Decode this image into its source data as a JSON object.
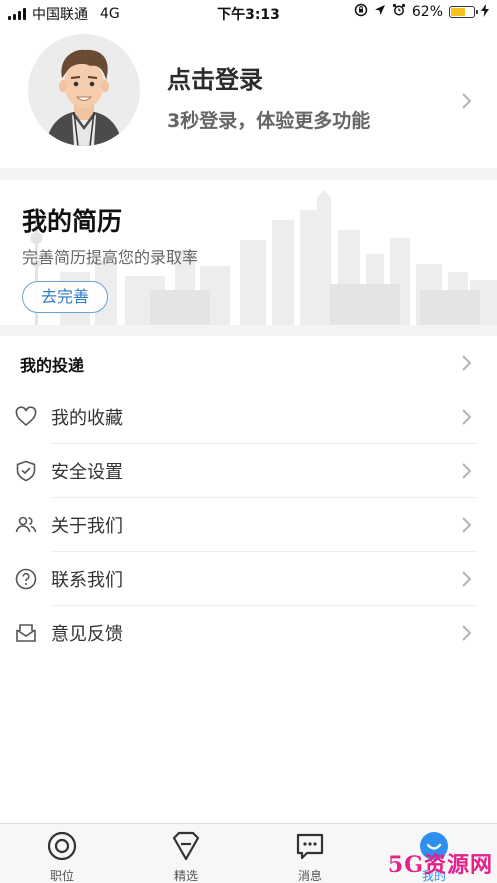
{
  "status_bar": {
    "carrier": "中国联通",
    "network": "4G",
    "time": "下午3:13",
    "battery_percent": "62%",
    "battery_level": 0.62,
    "battery_color": "#f5c11f"
  },
  "profile": {
    "avatar_icon": "user-avatar",
    "title": "点击登录",
    "subtitle": "3秒登录，体验更多功能"
  },
  "resume": {
    "title": "我的简历",
    "subtitle": "完善简历提高您的录取率",
    "button_label": "去完善",
    "accent": "#2f7bc4"
  },
  "menu": {
    "items": [
      {
        "label": "我的投递",
        "icon": "none"
      },
      {
        "label": "我的收藏",
        "icon": "heart-icon"
      },
      {
        "label": "安全设置",
        "icon": "shield-icon"
      },
      {
        "label": "关于我们",
        "icon": "users-icon"
      },
      {
        "label": "联系我们",
        "icon": "help-icon"
      },
      {
        "label": "意见反馈",
        "icon": "mail-icon"
      }
    ]
  },
  "tabbar": {
    "tabs": [
      {
        "label": "职位",
        "icon": "target-icon"
      },
      {
        "label": "精选",
        "icon": "shield-badge-icon"
      },
      {
        "label": "消息",
        "icon": "message-icon"
      },
      {
        "label": "我的",
        "icon": "smile-icon",
        "active": true
      }
    ],
    "active_color": "#2f8ff0"
  },
  "watermark": "5G资源网"
}
